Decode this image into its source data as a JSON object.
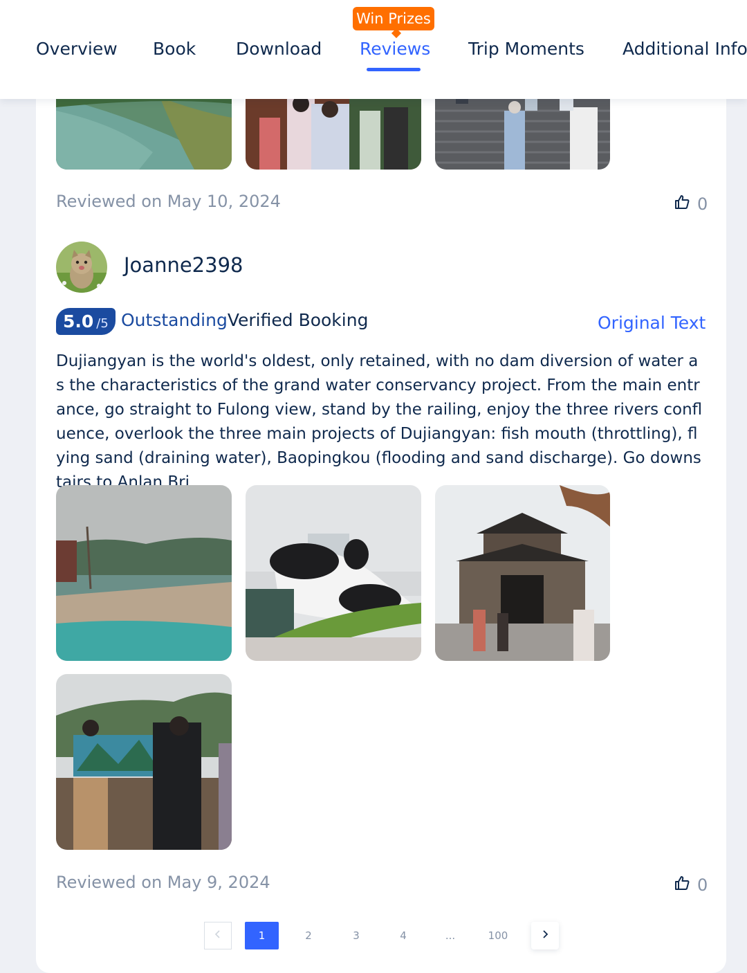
{
  "nav": {
    "tabs": [
      {
        "label": "Overview"
      },
      {
        "label": "Book"
      },
      {
        "label": "Download"
      },
      {
        "label": "Reviews"
      },
      {
        "label": "Trip Moments"
      },
      {
        "label": "Additional Info"
      }
    ],
    "active_tab": "Reviews",
    "badge": "Win Prizes"
  },
  "previous_review": {
    "date": "Reviewed on May 10, 2024",
    "likes": "0",
    "photos": [
      "river",
      "crowd-hall",
      "stairs-crowd"
    ]
  },
  "review": {
    "username": "Joanne2398",
    "avatar_icon": "kitten-avatar",
    "score": "5.0",
    "score_max": "/5",
    "rating_word": "Outstanding",
    "verified": "Verified Booking",
    "original_text_link": "Original Text",
    "text": "Dujiangyan is the world's oldest, only retained, with no dam diversion of water as the characteristics of the grand water conservancy project. From the main entrance, go straight to Fulong view, stand by the railing, enjoy the three rivers confluence, overlook the three main projects of Dujiangyan: fish mouth (throttling), flying sand (draining water), Baopingkou (flooding and sand discharge). Go downstairs to Anlan Bri...",
    "photos": [
      "river-bank",
      "panda-sculpture",
      "temple-gate",
      "painter"
    ],
    "date": "Reviewed on May 9, 2024",
    "likes": "0"
  },
  "pagination": {
    "pages": [
      "1",
      "2",
      "3",
      "4",
      "...",
      "100"
    ],
    "current": "1",
    "prev_icon": "chevron-left-icon",
    "next_icon": "chevron-right-icon"
  },
  "colors": {
    "accent": "#3264ff",
    "score_badge": "#1b4ba0",
    "prize_badge": "#ff6f00",
    "text_primary": "#0f294d",
    "text_secondary": "#8592a6"
  }
}
